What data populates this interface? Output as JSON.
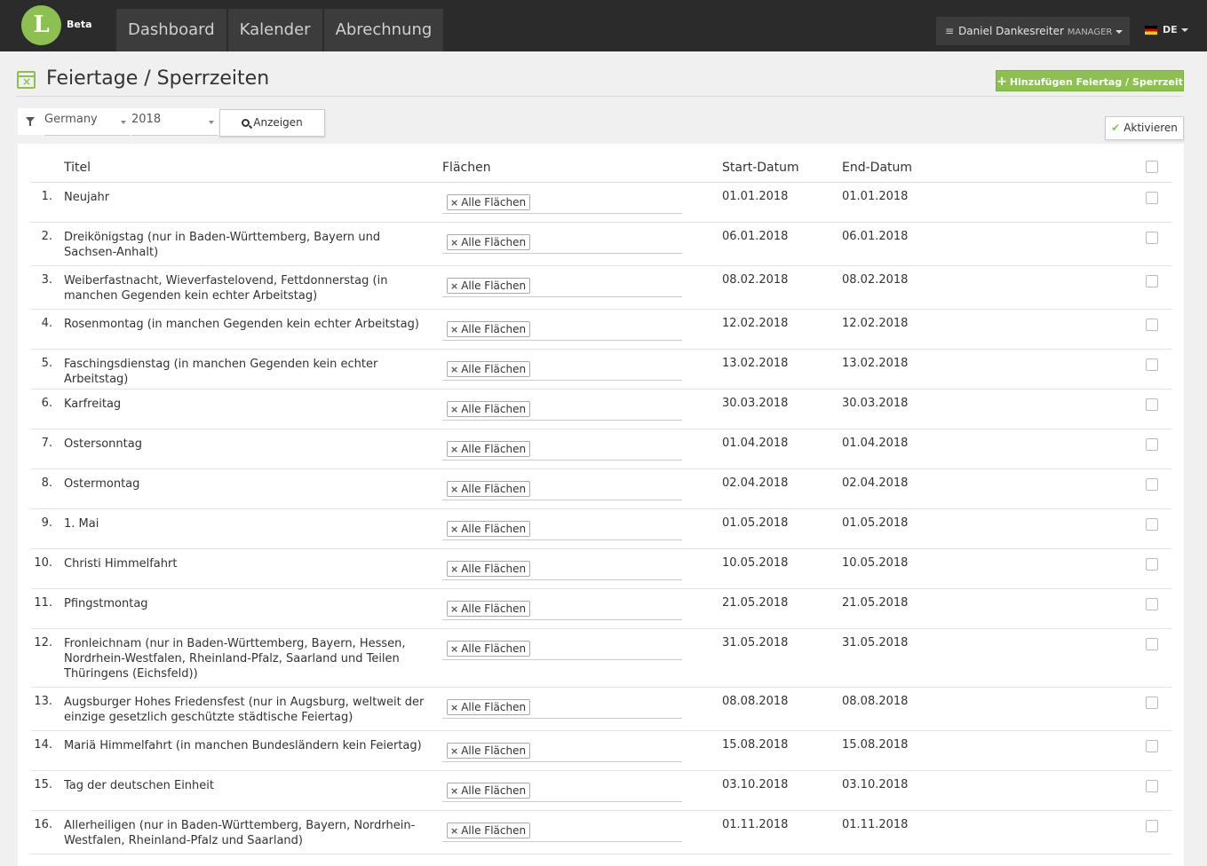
{
  "brand": {
    "logo_letter": "L",
    "badge": "Beta"
  },
  "nav": {
    "tabs": [
      "Dashboard",
      "Kalender",
      "Abrechnung"
    ]
  },
  "user": {
    "name": "Daniel Dankesreiter",
    "role": "MANAGER",
    "language": "DE"
  },
  "page": {
    "title": "Feiertage / Sperrzeiten",
    "add_button": "Hinzufügen Feiertag / Sperrzeit",
    "activate_button": "Aktivieren"
  },
  "filters": {
    "country": "Germany",
    "year": "2018",
    "show_button": "Anzeigen"
  },
  "colors": {
    "accent": "#8cc152",
    "navbar": "#2b2b2b"
  },
  "table": {
    "headers": {
      "title": "Titel",
      "areas": "Flächen",
      "start": "Start-Datum",
      "end": "End-Datum"
    },
    "rows": [
      {
        "num": "1.",
        "title": "Neujahr",
        "area": "Alle Flächen",
        "start": "01.01.2018",
        "end": "01.01.2018"
      },
      {
        "num": "2.",
        "title": "Dreikönigstag (nur in Baden-Württemberg, Bayern und Sachsen-Anhalt)",
        "area": "Alle Flächen",
        "start": "06.01.2018",
        "end": "06.01.2018"
      },
      {
        "num": "3.",
        "title": "Weiberfastnacht, Wieverfastelovend, Fettdonnerstag (in manchen Gegenden kein echter Arbeitstag)",
        "area": "Alle Flächen",
        "start": "08.02.2018",
        "end": "08.02.2018"
      },
      {
        "num": "4.",
        "title": "Rosenmontag (in manchen Gegenden kein echter Arbeitstag)",
        "area": "Alle Flächen",
        "start": "12.02.2018",
        "end": "12.02.2018"
      },
      {
        "num": "5.",
        "title": "Faschingsdienstag (in manchen Gegenden kein echter Arbeitstag)",
        "area": "Alle Flächen",
        "start": "13.02.2018",
        "end": "13.02.2018"
      },
      {
        "num": "6.",
        "title": "Karfreitag",
        "area": "Alle Flächen",
        "start": "30.03.2018",
        "end": "30.03.2018"
      },
      {
        "num": "7.",
        "title": "Ostersonntag",
        "area": "Alle Flächen",
        "start": "01.04.2018",
        "end": "01.04.2018"
      },
      {
        "num": "8.",
        "title": "Ostermontag",
        "area": "Alle Flächen",
        "start": "02.04.2018",
        "end": "02.04.2018"
      },
      {
        "num": "9.",
        "title": "1. Mai",
        "area": "Alle Flächen",
        "start": "01.05.2018",
        "end": "01.05.2018"
      },
      {
        "num": "10.",
        "title": "Christi Himmelfahrt",
        "area": "Alle Flächen",
        "start": "10.05.2018",
        "end": "10.05.2018"
      },
      {
        "num": "11.",
        "title": "Pfingstmontag",
        "area": "Alle Flächen",
        "start": "21.05.2018",
        "end": "21.05.2018"
      },
      {
        "num": "12.",
        "title": "Fronleichnam (nur in Baden-Württemberg, Bayern, Hessen, Nordrhein-Westfalen, Rheinland-Pfalz, Saarland und Teilen Thüringens (Eichsfeld))",
        "area": "Alle Flächen",
        "start": "31.05.2018",
        "end": "31.05.2018"
      },
      {
        "num": "13.",
        "title": "Augsburger Hohes Friedensfest (nur in Augsburg, weltweit der einzige gesetzlich geschützte städtische Feiertag)",
        "area": "Alle Flächen",
        "start": "08.08.2018",
        "end": "08.08.2018"
      },
      {
        "num": "14.",
        "title": "Mariä Himmelfahrt (in manchen Bundesländern kein Feiertag)",
        "area": "Alle Flächen",
        "start": "15.08.2018",
        "end": "15.08.2018"
      },
      {
        "num": "15.",
        "title": "Tag der deutschen Einheit",
        "area": "Alle Flächen",
        "start": "03.10.2018",
        "end": "03.10.2018"
      },
      {
        "num": "16.",
        "title": "Allerheiligen (nur in Baden-Württemberg, Bayern, Nordrhein-Westfalen, Rheinland-Pfalz und Saarland)",
        "area": "Alle Flächen",
        "start": "01.11.2018",
        "end": "01.11.2018"
      }
    ]
  }
}
